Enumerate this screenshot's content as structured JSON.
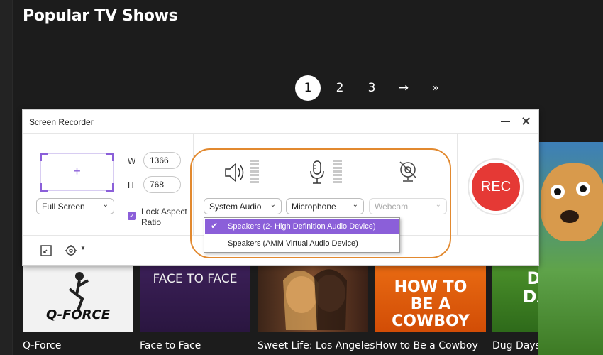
{
  "page": {
    "title": "Popular TV Shows",
    "pagination": [
      "1",
      "2",
      "3",
      "→",
      "»"
    ],
    "active_page": "1"
  },
  "shows": [
    {
      "title": "Q-Force",
      "logo": "Q-FORCE"
    },
    {
      "title": "Face to Face",
      "logo": "FACE TO FACE"
    },
    {
      "title": "Sweet Life: Los Angeles",
      "logo": ""
    },
    {
      "title": "How to Be a Cowboy",
      "logo": "HOW TO BE A COWBOY"
    },
    {
      "title": "Dug Days",
      "logo": "DUG DAYS"
    }
  ],
  "recorder": {
    "title": "Screen Recorder",
    "capture_mode": "Full Screen",
    "width_label": "W",
    "height_label": "H",
    "width_value": "1366",
    "height_value": "768",
    "lock_aspect_label": "Lock Aspect Ratio",
    "lock_aspect_checked": true,
    "system_audio_label": "System Audio",
    "microphone_label": "Microphone",
    "webcam_label": "Webcam",
    "rec_label": "REC",
    "dropdown_items": [
      {
        "label": "Speakers (2- High Definition Audio Device)",
        "selected": true
      },
      {
        "label": "Speakers (AMM Virtual Audio Device)",
        "selected": false
      }
    ]
  },
  "colors": {
    "accent": "#8b5fd9",
    "rec": "#e53935",
    "highlight": "#e2892f"
  }
}
